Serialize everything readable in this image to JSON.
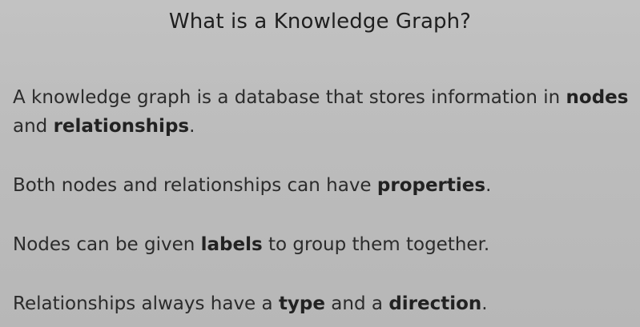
{
  "slide": {
    "title": "What is a Knowledge Graph?",
    "p1": {
      "t1": "A knowledge graph is a database that stores information in ",
      "b1": "nodes",
      "t2": " and ",
      "b2": "relationships",
      "t3": "."
    },
    "p2": {
      "t1": "Both nodes and relationships can have ",
      "b1": "properties",
      "t2": "."
    },
    "p3": {
      "t1": "Nodes can be given ",
      "b1": "labels",
      "t2": " to group them together."
    },
    "p4": {
      "t1": "Relationships always have a ",
      "b1": "type",
      "t2": " and a ",
      "b2": "direction",
      "t3": "."
    }
  }
}
